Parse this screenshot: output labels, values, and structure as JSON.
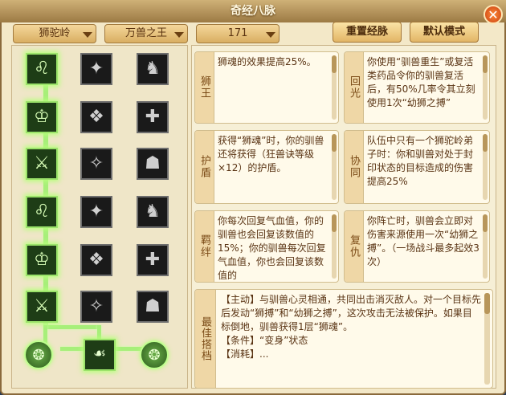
{
  "window": {
    "title": "奇经八脉"
  },
  "filters": {
    "sect": "狮驼岭",
    "skill": "万兽之王",
    "level": "171"
  },
  "buttons": {
    "reset": "重置经脉",
    "default": "默认模式"
  },
  "colors": {
    "active_glow": "#9be36a",
    "frame": "#8a6a3c",
    "panel": "#f3e8c8"
  },
  "skill_tree": {
    "icons": [
      [
        "lion-head-icon",
        "lion-face-icon",
        "lion-roar-icon"
      ],
      [
        "lion-plus-icon",
        "beast-burst-icon",
        "shield-beast-icon"
      ],
      [
        "armor-icon",
        "wolf-head-icon",
        "running-beast-icon"
      ],
      [
        "dragon-icon",
        "fist-sword-icon",
        "beast-mask-icon"
      ],
      [
        "rabbit-icon",
        "bone-icon",
        "eagle-icon"
      ],
      [
        "runner-icon",
        "skull-plus-icon",
        "heart-plus-icon"
      ]
    ],
    "final_icons": [
      "left-orb-icon",
      "claw-icon",
      "right-orb-icon"
    ]
  },
  "skills": [
    {
      "label": "狮王",
      "text": "狮魂的效果提高25%。"
    },
    {
      "label": "回光",
      "text": "你使用“驯兽重生”或复活类药品令你的驯兽复活后，有50%几率令其立刻使用1次“幼狮之搏”"
    },
    {
      "label": "护盾",
      "text": "获得“狮魂”时，你的驯兽还将获得（狂兽诀等级×12）的护盾。"
    },
    {
      "label": "协同",
      "text": "队伍中只有一个狮驼岭弟子时：你和驯兽对处于封印状态的目标造成的伤害提高25%"
    },
    {
      "label": "羁绊",
      "text": "你每次回复气血值，你的驯兽也会回复该数值的15%；你的驯兽每次回复气血值，你也会回复该数值的"
    },
    {
      "label": "复仇",
      "text": "你阵亡时，驯兽会立即对伤害来源使用一次“幼狮之搏”。（一场战斗最多起效3次）"
    }
  ],
  "best": {
    "label": "最佳搭档",
    "line1": "【主动】与驯兽心灵相通，共同出击消灭敌人。对一个目标先后发动“狮搏”和“幼狮之搏”，这次攻击无法被保护。如果目标倒地，驯兽获得1层“狮魂”。",
    "line2": "【条件】“变身”状态",
    "line3": "【消耗】..."
  }
}
